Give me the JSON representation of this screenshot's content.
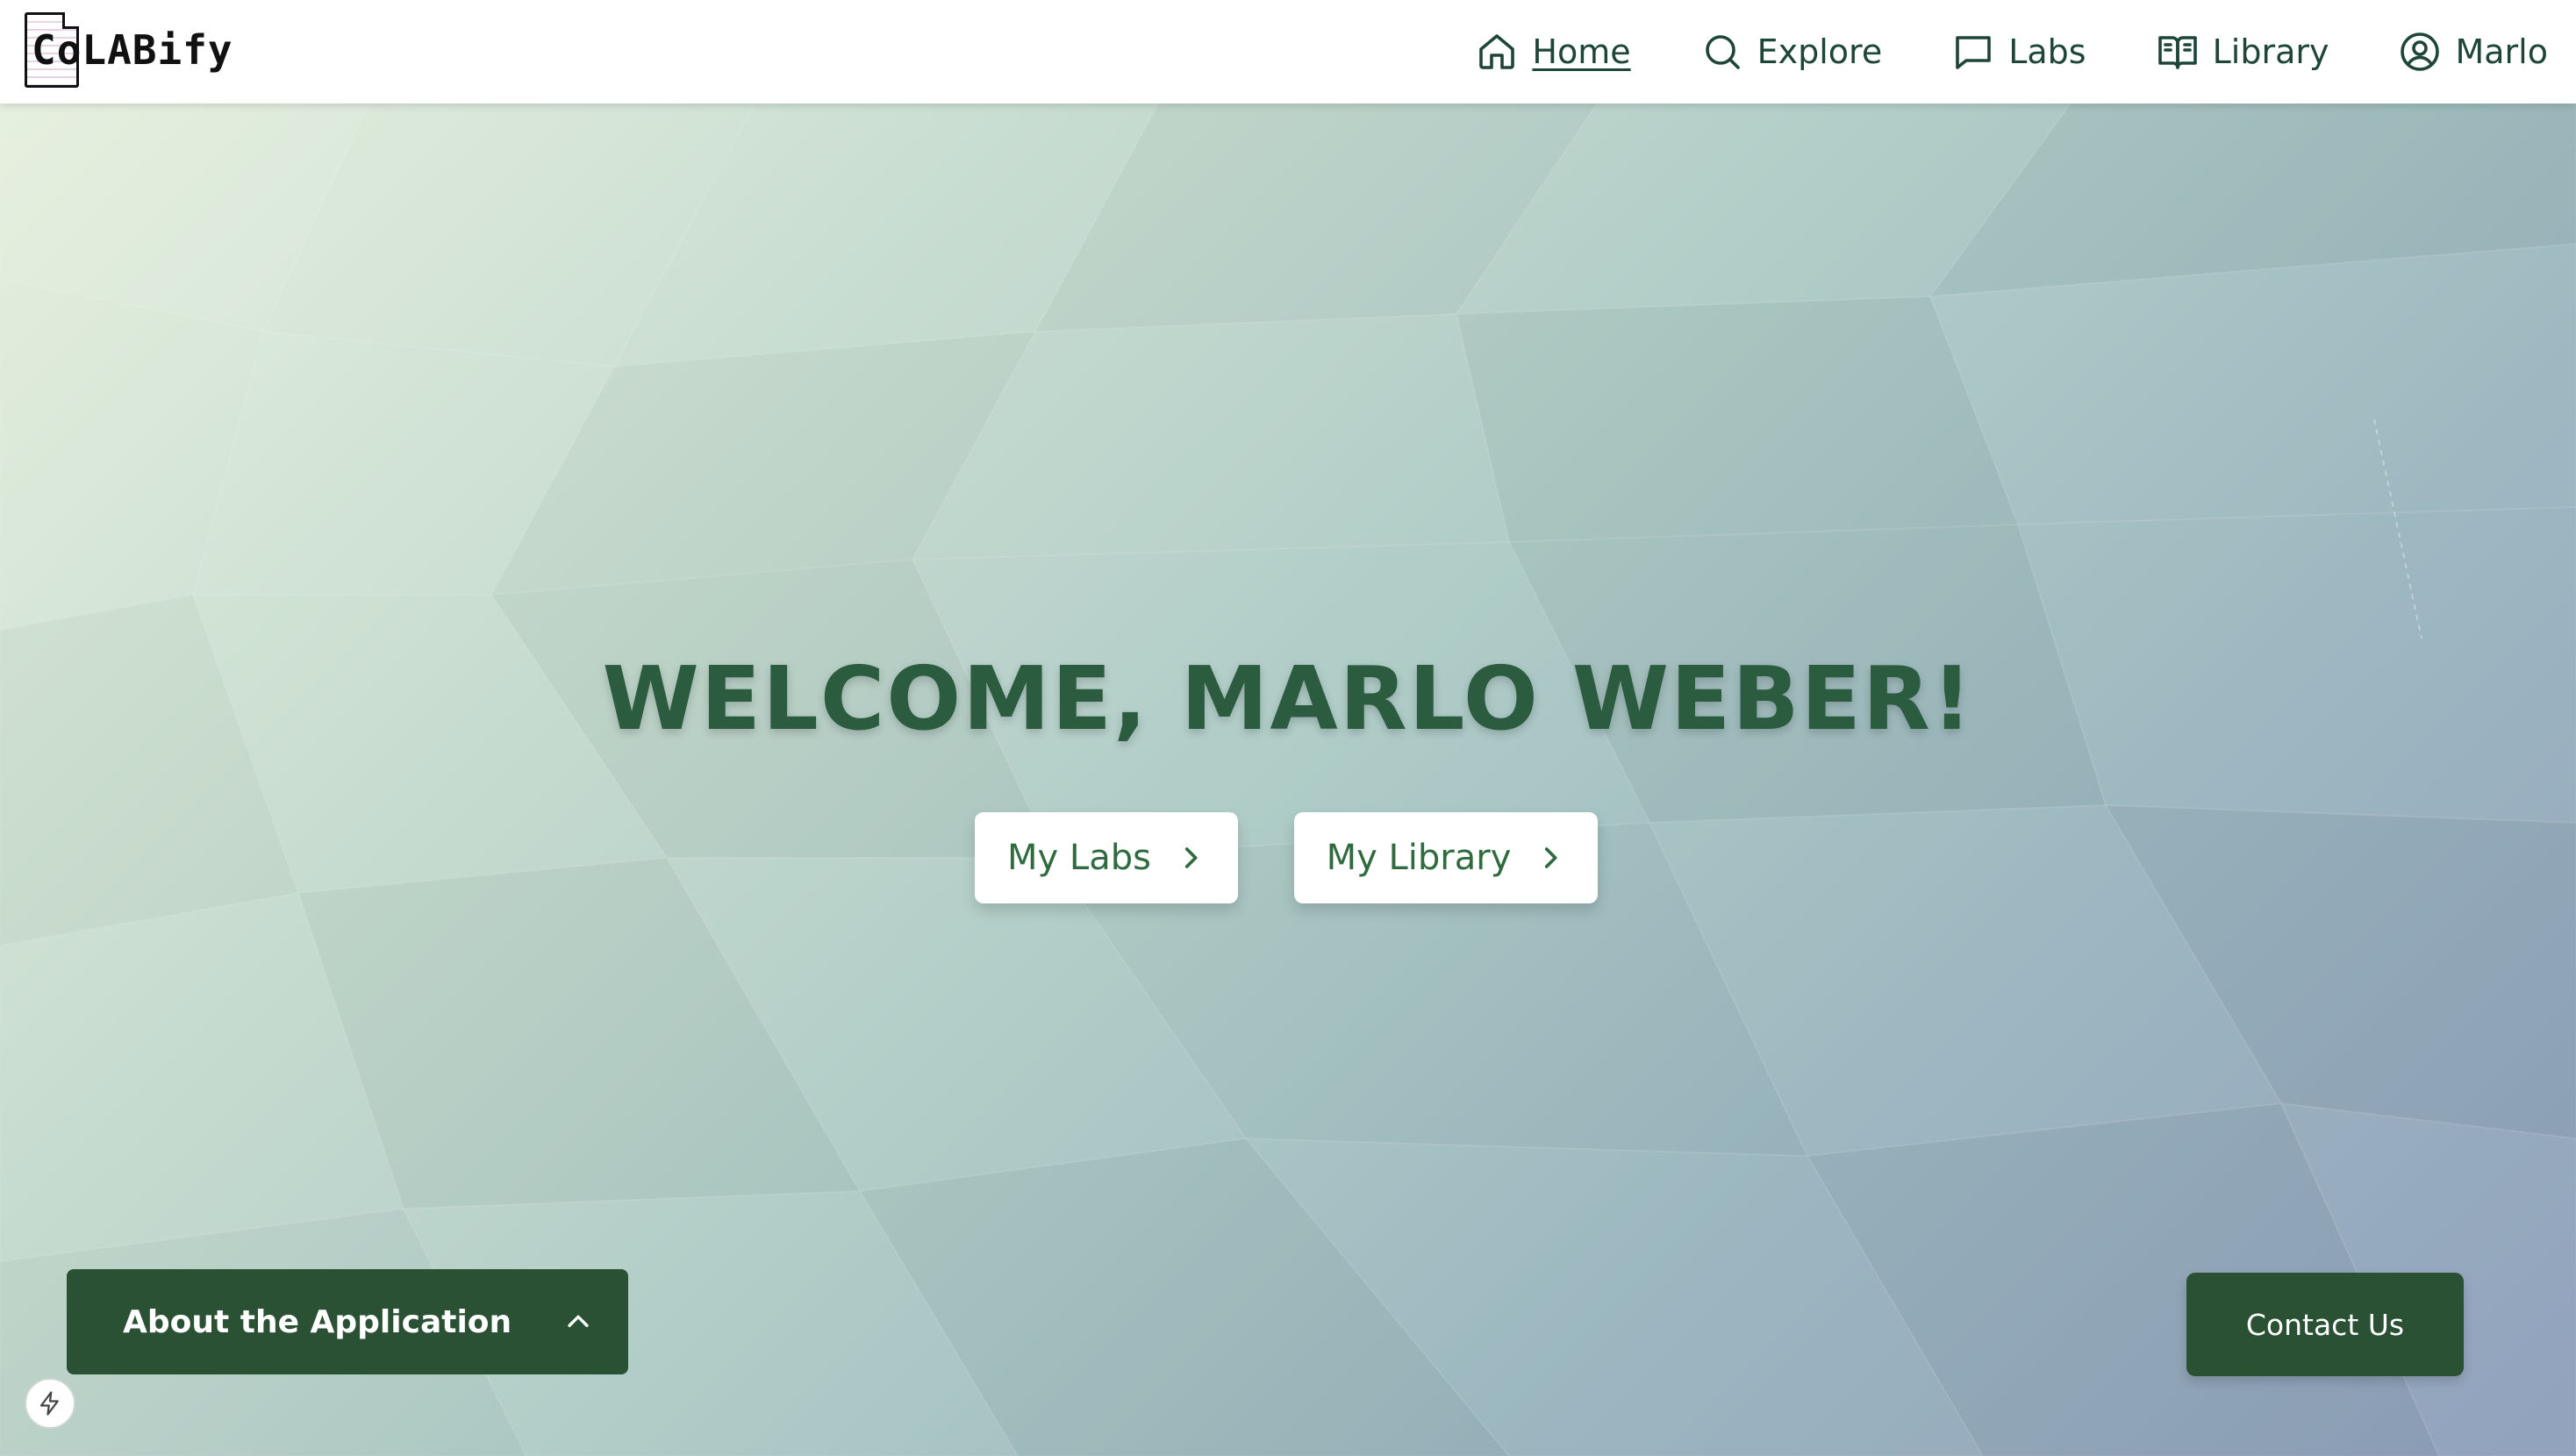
{
  "brand": {
    "logo_text": "CoLABify"
  },
  "nav": {
    "items": [
      {
        "label": "Home",
        "icon": "home-icon",
        "active": true
      },
      {
        "label": "Explore",
        "icon": "search-icon",
        "active": false
      },
      {
        "label": "Labs",
        "icon": "message-icon",
        "active": false
      },
      {
        "label": "Library",
        "icon": "book-icon",
        "active": false
      },
      {
        "label": "Marlo",
        "icon": "user-circle-icon",
        "active": false
      }
    ]
  },
  "hero": {
    "welcome": "WELCOME, MARLO WEBER!",
    "buttons": [
      {
        "label": "My Labs",
        "icon": "chevron-right-icon"
      },
      {
        "label": "My Library",
        "icon": "chevron-right-icon"
      }
    ]
  },
  "about": {
    "label": "About the Application",
    "icon": "chevron-up-icon"
  },
  "contact": {
    "label": "Contact Us"
  },
  "quick_action": {
    "icon": "bolt-icon"
  },
  "colors": {
    "primary_dark_green": "#2b5135",
    "heading_green": "#2b5c40",
    "nav_text": "#1e4638",
    "button_text": "#2f6b3e"
  }
}
